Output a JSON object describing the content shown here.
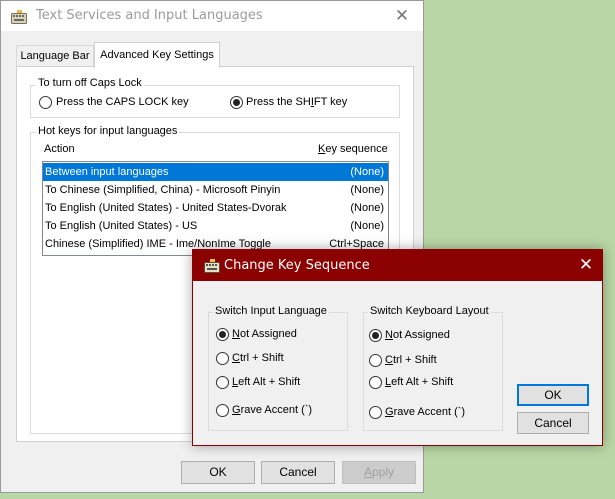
{
  "main_window": {
    "title": "Text Services and Input Languages",
    "close_glyph": "✕",
    "tabs": [
      {
        "label": "Language Bar"
      },
      {
        "label": "Advanced Key Settings"
      }
    ],
    "capslock": {
      "legend": "To turn off Caps Lock",
      "option_caps": "Press the CAPS LOCK key",
      "option_shift": "Press the SHIFT key",
      "selected": "shift"
    },
    "hotkeys": {
      "legend": "Hot keys for input languages",
      "col_action": "Action",
      "col_sequence": "Key sequence",
      "rows": [
        {
          "action": "Between input languages",
          "sequence": "(None)"
        },
        {
          "action": "To Chinese (Simplified, China) - Microsoft Pinyin",
          "sequence": "(None)"
        },
        {
          "action": "To English (United States) - United States-Dvorak",
          "sequence": "(None)"
        },
        {
          "action": "To English (United States) - US",
          "sequence": "(None)"
        },
        {
          "action": "Chinese (Simplified) IME - Ime/NonIme Toggle",
          "sequence": "Ctrl+Space"
        }
      ],
      "selected_row": 0
    },
    "buttons": {
      "ok": "OK",
      "cancel": "Cancel",
      "apply": "Apply"
    }
  },
  "dialog": {
    "title": "Change Key Sequence",
    "close_glyph": "✕",
    "switch_input": {
      "legend": "Switch Input Language",
      "options": [
        {
          "ul": "N",
          "rest": "ot Assigned"
        },
        {
          "ul": "C",
          "rest": "trl + Shift"
        },
        {
          "ul": "L",
          "rest": "eft Alt + Shift"
        },
        {
          "ul": "G",
          "rest": "rave Accent (`)"
        }
      ],
      "selected": 0
    },
    "switch_layout": {
      "legend": "Switch Keyboard Layout",
      "options": [
        {
          "ul": "N",
          "rest": "ot Assigned"
        },
        {
          "ul": "C",
          "rest": "trl + Shift"
        },
        {
          "ul": "L",
          "rest": "eft Alt + Shift"
        },
        {
          "ul": "G",
          "rest": "rave Accent (`)"
        }
      ],
      "selected": 0
    },
    "buttons": {
      "ok": "OK",
      "cancel": "Cancel"
    }
  },
  "colors": {
    "selection": "#0078d7",
    "dialog_titlebar": "#8b0000",
    "background": "#b9d7a6"
  },
  "icons": {
    "app": "keyboard-icon",
    "close": "close-icon"
  }
}
